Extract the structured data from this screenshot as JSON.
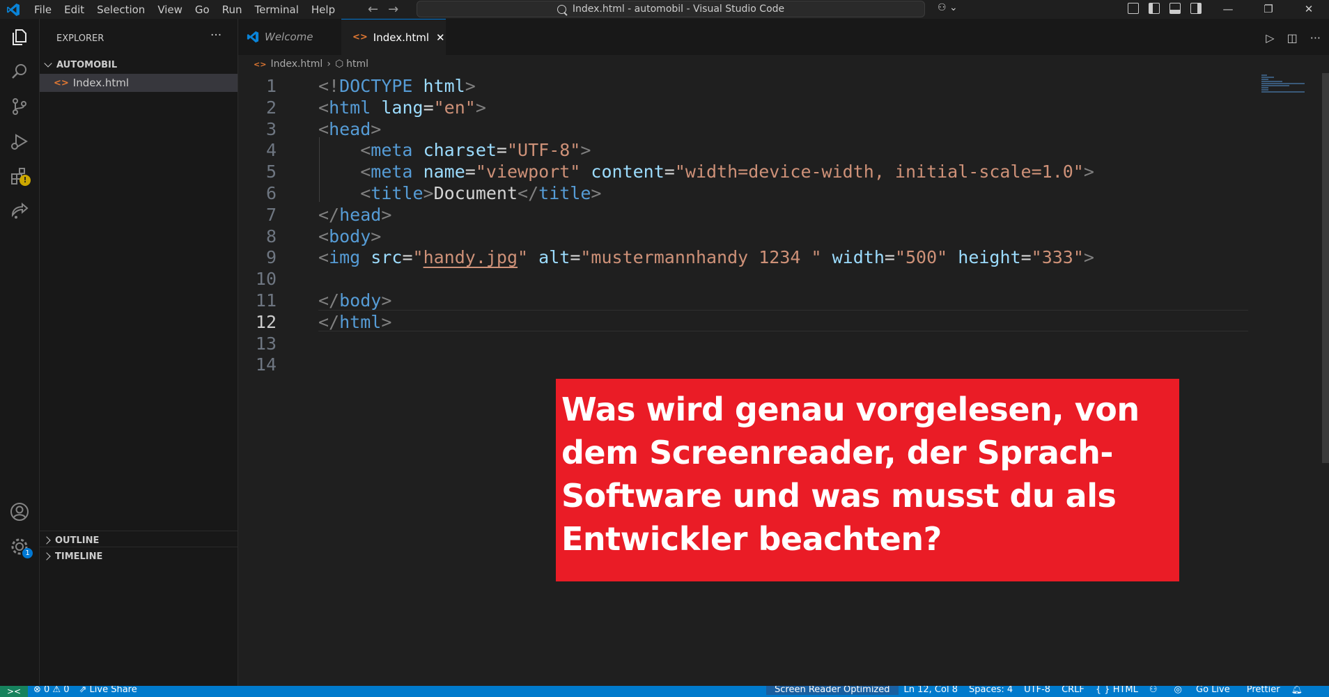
{
  "menu": [
    "File",
    "Edit",
    "Selection",
    "View",
    "Go",
    "Run",
    "Terminal",
    "Help"
  ],
  "window_title": "Index.html - automobil - Visual Studio Code",
  "sidebar": {
    "title": "EXPLORER",
    "folder": "AUTOMOBIL",
    "file": "Index.html",
    "outline": "OUTLINE",
    "timeline": "TIMELINE"
  },
  "tabs": {
    "welcome": "Welcome",
    "active": "Index.html"
  },
  "breadcrumb": {
    "file": "Index.html",
    "symbol": "html"
  },
  "code": {
    "active_line": 12,
    "lines": [
      [
        [
          "p",
          "<!"
        ],
        [
          "tag",
          "DOCTYPE"
        ],
        [
          "text",
          " "
        ],
        [
          "attr",
          "html"
        ],
        [
          "p",
          ">"
        ]
      ],
      [
        [
          "p",
          "<"
        ],
        [
          "tag",
          "html"
        ],
        [
          "text",
          " "
        ],
        [
          "attr",
          "lang"
        ],
        [
          "text",
          "="
        ],
        [
          "str",
          "\"en\""
        ],
        [
          "p",
          ">"
        ]
      ],
      [
        [
          "p",
          "<"
        ],
        [
          "tag",
          "head"
        ],
        [
          "p",
          ">"
        ]
      ],
      [
        [
          "text",
          "    "
        ],
        [
          "p",
          "<"
        ],
        [
          "tag",
          "meta"
        ],
        [
          "text",
          " "
        ],
        [
          "attr",
          "charset"
        ],
        [
          "text",
          "="
        ],
        [
          "str",
          "\"UTF-8\""
        ],
        [
          "p",
          ">"
        ]
      ],
      [
        [
          "text",
          "    "
        ],
        [
          "p",
          "<"
        ],
        [
          "tag",
          "meta"
        ],
        [
          "text",
          " "
        ],
        [
          "attr",
          "name"
        ],
        [
          "text",
          "="
        ],
        [
          "str",
          "\"viewport\""
        ],
        [
          "text",
          " "
        ],
        [
          "attr",
          "content"
        ],
        [
          "text",
          "="
        ],
        [
          "str",
          "\"width=device-width, initial-scale=1.0\""
        ],
        [
          "p",
          ">"
        ]
      ],
      [
        [
          "text",
          "    "
        ],
        [
          "p",
          "<"
        ],
        [
          "tag",
          "title"
        ],
        [
          "p",
          ">"
        ],
        [
          "text",
          "Document"
        ],
        [
          "p",
          "</"
        ],
        [
          "tag",
          "title"
        ],
        [
          "p",
          ">"
        ]
      ],
      [
        [
          "p",
          "</"
        ],
        [
          "tag",
          "head"
        ],
        [
          "p",
          ">"
        ]
      ],
      [
        [
          "p",
          "<"
        ],
        [
          "tag",
          "body"
        ],
        [
          "p",
          ">"
        ]
      ],
      [
        [
          "p",
          "<"
        ],
        [
          "tag",
          "img"
        ],
        [
          "text",
          " "
        ],
        [
          "attr",
          "src"
        ],
        [
          "text",
          "="
        ],
        [
          "str",
          "\""
        ],
        [
          "link",
          "handy.jpg"
        ],
        [
          "str",
          "\""
        ],
        [
          "text",
          " "
        ],
        [
          "attr",
          "alt"
        ],
        [
          "text",
          "="
        ],
        [
          "str",
          "\"mustermannhandy 1234 \""
        ],
        [
          "text",
          " "
        ],
        [
          "attr",
          "width"
        ],
        [
          "text",
          "="
        ],
        [
          "str",
          "\"500\""
        ],
        [
          "text",
          " "
        ],
        [
          "attr",
          "height"
        ],
        [
          "text",
          "="
        ],
        [
          "str",
          "\"333\""
        ],
        [
          "p",
          ">"
        ]
      ],
      [],
      [
        [
          "p",
          "</"
        ],
        [
          "tag",
          "body"
        ],
        [
          "p",
          ">"
        ]
      ],
      [
        [
          "p",
          "</"
        ],
        [
          "tag",
          "html"
        ],
        [
          "p",
          ">"
        ]
      ],
      [],
      []
    ]
  },
  "overlay": {
    "text": "Was wird genau vorgelesen, von dem Screenreader, der Sprach-Software und was musst du als Entwickler beachten?",
    "color": "#ea1c26"
  },
  "status": {
    "remote": "><",
    "problems": "⊗ 0 ⚠ 0",
    "live_share": "Live Share",
    "screen_reader": "Screen Reader Optimized",
    "position": "Ln 12, Col 8",
    "spaces": "Spaces: 4",
    "encoding": "UTF-8",
    "eol": "CRLF",
    "language": "{ } HTML",
    "go_live": "Go Live",
    "prettier": "Prettier"
  },
  "icons": [
    "vscode-logo-icon",
    "files-icon",
    "search-icon",
    "source-control-icon",
    "run-debug-icon",
    "extensions-icon",
    "live-share-icon",
    "account-icon",
    "settings-gear-icon"
  ],
  "colors": {
    "accent": "#007acc",
    "tag": "#569cd6",
    "attr": "#9cdcfe",
    "string": "#ce9178"
  }
}
